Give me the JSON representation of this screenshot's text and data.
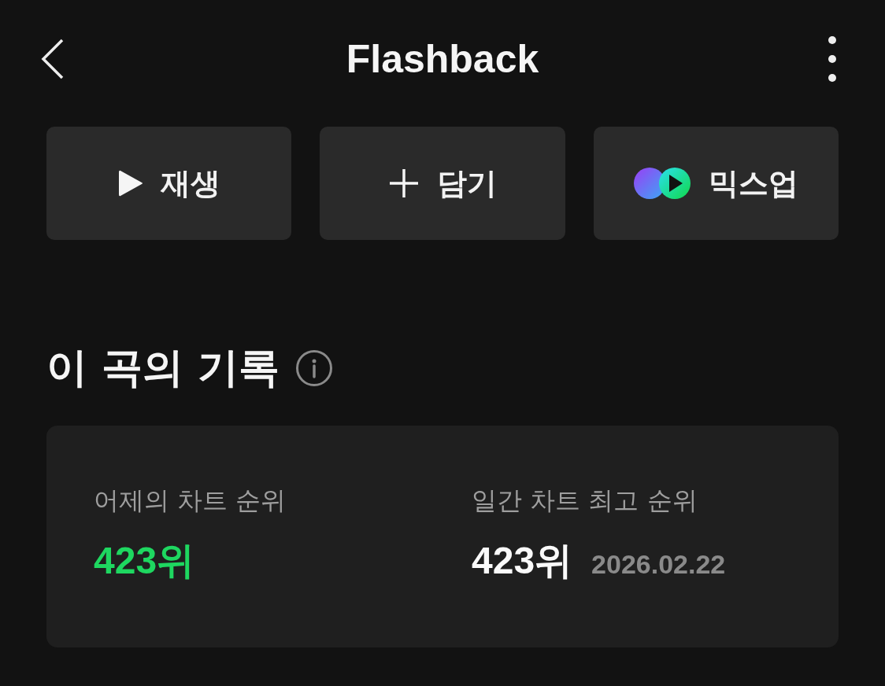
{
  "header": {
    "title": "Flashback"
  },
  "actions": [
    {
      "kind": "play",
      "label": "재생"
    },
    {
      "kind": "add",
      "label": "담기"
    },
    {
      "kind": "mixup",
      "label": "믹스업"
    }
  ],
  "section": {
    "title": "이 곡의 기록"
  },
  "stats": [
    {
      "label": "어제의 차트 순위",
      "value": "423위",
      "highlight": true
    },
    {
      "label": "일간 차트 최고 순위",
      "value": "423위",
      "highlight": false,
      "date": "2026.02.22"
    }
  ]
}
